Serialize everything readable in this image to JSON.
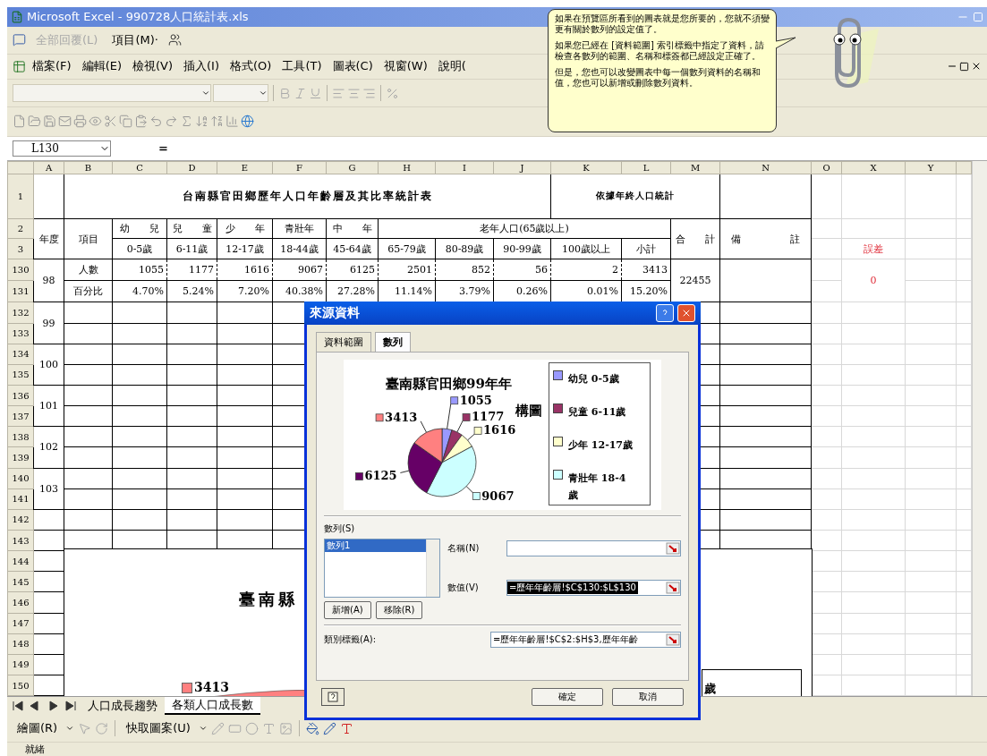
{
  "window": {
    "title": "Microsoft Excel - 990728人口統計表.xls"
  },
  "reviewing_toolbar": {
    "items": [
      {
        "label": "全部回覆(L)",
        "disabled": true
      },
      {
        "label": "項目(M)·",
        "disabled": false
      }
    ]
  },
  "menu_bar": [
    "檔案(F)",
    "編輯(E)",
    "檢視(V)",
    "插入(I)",
    "格式(O)",
    "工具(T)",
    "圖表(C)",
    "視窗(W)",
    "說明("
  ],
  "formula_bar": {
    "name_box": "L130",
    "equals": "="
  },
  "assistant_balloon": {
    "paragraphs": [
      "如果在預覽區所看到的圖表就是您所要的，您就不須變更有關於數列的設定值了。",
      "如果您已經在 [資料範圍] 索引標籤中指定了資料，請檢查各數列的範圍、名稱和標簽都已經設定正確了。",
      "但是，您也可以改變圖表中每一個數列資料的名稱和值，您也可以新增或刪除數列資料。"
    ]
  },
  "sheet": {
    "columns": [
      "A",
      "B",
      "C",
      "D",
      "E",
      "F",
      "G",
      "H",
      "I",
      "J",
      "K",
      "L",
      "M",
      "N",
      "O",
      "X",
      "Y"
    ],
    "row_numbers": [
      "1",
      "2",
      "3",
      "130",
      "131",
      "132",
      "133",
      "134",
      "135",
      "136",
      "137",
      "138",
      "139",
      "140",
      "141",
      "142",
      "143",
      "144",
      "145",
      "146",
      "147",
      "148",
      "149",
      "150"
    ],
    "title": "台南縣官田鄉歷年人口年齡層及其比率統計表",
    "source_note": "依據年終人口統計",
    "header": {
      "year": "年度",
      "item": "項目",
      "groups": [
        {
          "label": "幼　　兒",
          "range": "0-5歲"
        },
        {
          "label": "兒　　童",
          "range": "6-11歲"
        },
        {
          "label": "少　　年",
          "range": "12-17歲"
        },
        {
          "label": "青壯年",
          "range": "18-44歲"
        },
        {
          "label": "中　　年",
          "range": "45-64歲"
        }
      ],
      "elderly": {
        "label": "老年人口(65歲以上)",
        "ranges": [
          "65-79歲",
          "80-89歲",
          "90-99歲",
          "100歲以上",
          "小計"
        ]
      },
      "total": "合　　計",
      "remark": "備　　　　　註",
      "check": "誤差"
    },
    "years": [
      {
        "year": "98",
        "rows": [
          {
            "item": "人數",
            "copy_range": true,
            "values": [
              "1055",
              "1177",
              "1616",
              "9067",
              "6125",
              "2501",
              "852",
              "56",
              "2",
              "3413"
            ],
            "total": "22455",
            "check": "0"
          },
          {
            "item": "百分比",
            "copy_range": false,
            "values": [
              "4.70%",
              "5.24%",
              "7.20%",
              "40.38%",
              "27.28%",
              "11.14%",
              "3.79%",
              "0.26%",
              "0.01%",
              "15.20%"
            ]
          }
        ]
      },
      {
        "year": "99"
      },
      {
        "year": "100"
      },
      {
        "year": "101"
      },
      {
        "year": "102"
      },
      {
        "year": "103"
      }
    ],
    "embedded_chart": {
      "title": "臺南縣",
      "label": "3413",
      "legend_fragment": "歲"
    }
  },
  "sheet_tabs": [
    {
      "label": "人口成長趨勢",
      "selected": false
    },
    {
      "label": "各類人口成長數",
      "selected": true
    }
  ],
  "drawing_toolbar": {
    "draw_menu": "繪圖(R)",
    "autoshapes": "快取圖案(U)"
  },
  "status_bar": "就緒",
  "dialog": {
    "title": "來源資料",
    "tabs": [
      {
        "label": "資料範圍",
        "selected": false
      },
      {
        "label": "數列",
        "selected": true
      }
    ],
    "preview": {
      "title_lines": [
        "臺南縣官田鄉99年年",
        "構圖"
      ],
      "slices": [
        {
          "color": "#9999ff"
        },
        {
          "color": "#993366"
        },
        {
          "color": "#ffffcc"
        },
        {
          "color": "#ccffff"
        },
        {
          "color": "#660066"
        },
        {
          "color": "#ff8080"
        }
      ],
      "legend": [
        {
          "lines": [
            "幼兒 0-5歲"
          ],
          "color": "#9999ff"
        },
        {
          "lines": [
            "兒童 6-11歲"
          ],
          "color": "#993366"
        },
        {
          "lines": [
            "少年 12-17歲"
          ],
          "color": "#ffffcc"
        },
        {
          "lines": [
            "青壯年 18-4",
            "歲"
          ],
          "color": "#ccffff"
        }
      ],
      "chart_data": {
        "type": "pie",
        "values": [
          1055,
          1177,
          1616,
          9067,
          6125,
          3413
        ],
        "value_labels": [
          "1055",
          "1177",
          "1616",
          "9067",
          "6125",
          "3413"
        ]
      }
    },
    "series_list": {
      "label": "數列(S)",
      "items": [
        {
          "label": "數列1",
          "selected": true
        }
      ]
    },
    "name_field": {
      "label": "名稱(N)"
    },
    "values_field": {
      "label": "數值(V)",
      "value": "=歷年年齡層!$C$130:$L$130",
      "highlighted": true
    },
    "add_button": "新增(A)",
    "remove_button": "移除(R)",
    "category_field": {
      "label": "類別標籤(A):",
      "value": "=歷年年齡層!$C$2:$H$3,歷年年齡"
    },
    "ok_button": "確定",
    "cancel_button": "取消"
  }
}
